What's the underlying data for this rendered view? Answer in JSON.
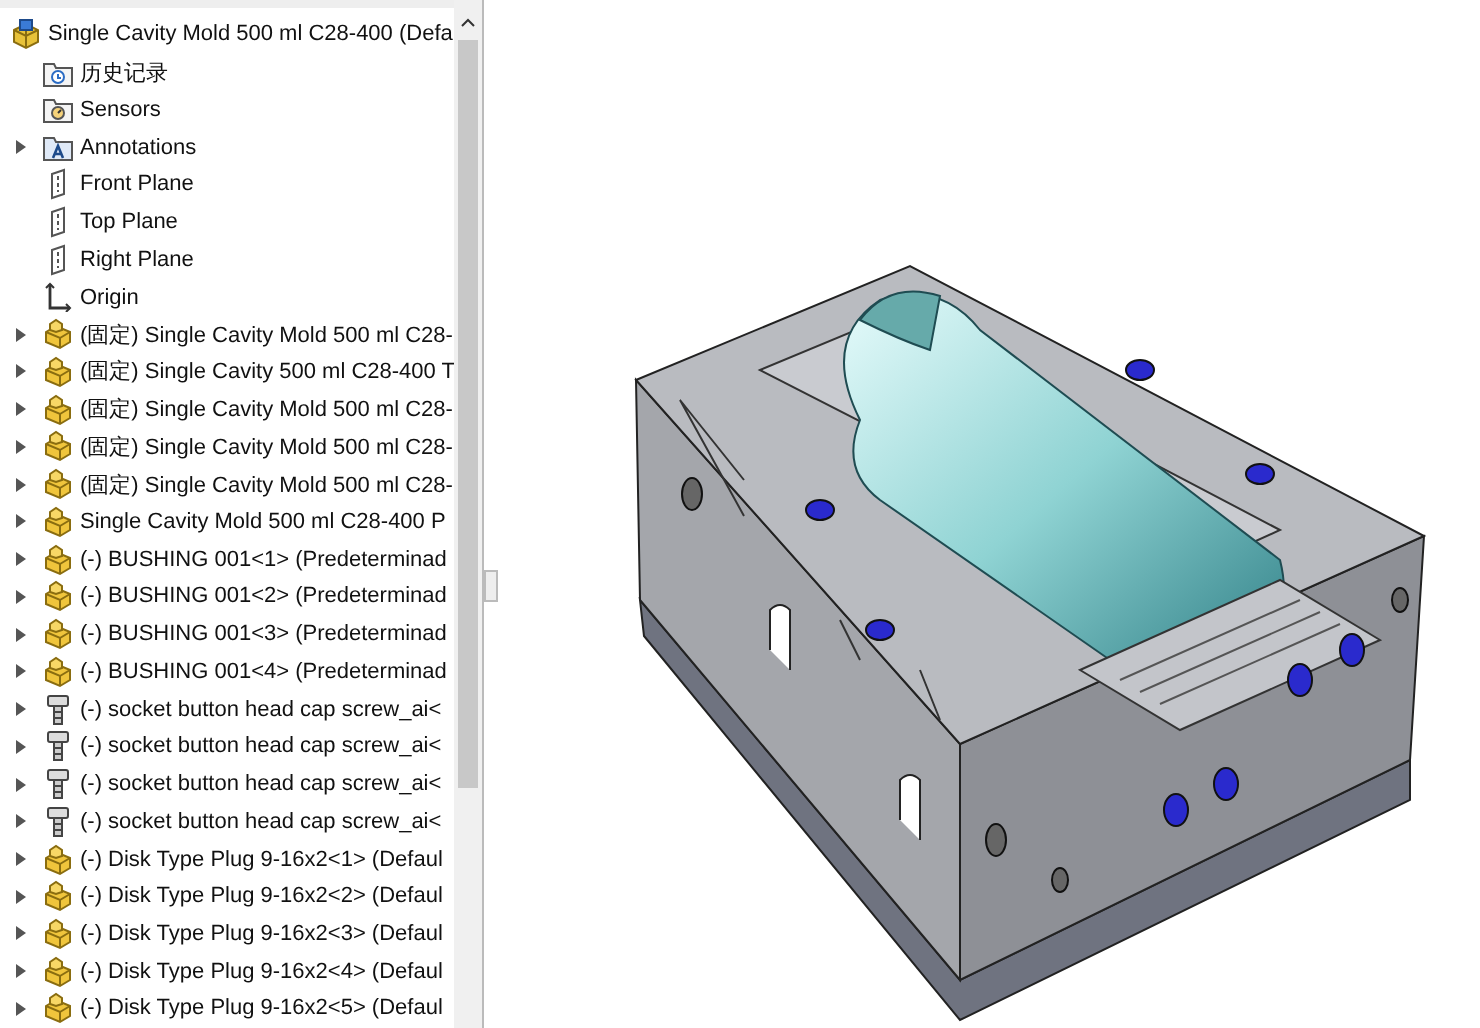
{
  "feature_tree": [
    {
      "label": "Single Cavity Mold 500 ml C28-400  (Defa",
      "kind": "assembly",
      "children": [
        {
          "label": "历史记录",
          "kind": "history"
        },
        {
          "label": "Sensors",
          "kind": "sensors"
        },
        {
          "label": "Annotations",
          "kind": "annotations",
          "expanded": false
        },
        {
          "label": "Front Plane",
          "kind": "plane"
        },
        {
          "label": "Top Plane",
          "kind": "plane"
        },
        {
          "label": "Right Plane",
          "kind": "plane"
        },
        {
          "label": "Origin",
          "kind": "origin"
        },
        {
          "label": "(固定) Single Cavity Mold 500 ml C28-",
          "kind": "part",
          "expanded": false
        },
        {
          "label": "(固定) Single Cavity 500 ml C28-400 T",
          "kind": "part",
          "expanded": false
        },
        {
          "label": "(固定) Single Cavity Mold 500 ml C28-",
          "kind": "part",
          "expanded": false
        },
        {
          "label": "(固定) Single Cavity Mold 500 ml C28-",
          "kind": "part",
          "expanded": false
        },
        {
          "label": "(固定) Single Cavity Mold 500 ml C28-",
          "kind": "part",
          "expanded": false
        },
        {
          "label": "Single Cavity Mold 500 ml C28-400 P",
          "kind": "part",
          "expanded": false
        },
        {
          "label": "(-) BUSHING 001<1> (Predeterminad",
          "kind": "part",
          "expanded": false
        },
        {
          "label": "(-) BUSHING 001<2> (Predeterminad",
          "kind": "part",
          "expanded": false
        },
        {
          "label": "(-) BUSHING 001<3> (Predeterminad",
          "kind": "part",
          "expanded": false
        },
        {
          "label": "(-) BUSHING 001<4> (Predeterminad",
          "kind": "part",
          "expanded": false
        },
        {
          "label": "(-) socket button head cap screw_ai<",
          "kind": "screw",
          "expanded": false
        },
        {
          "label": "(-) socket button head cap screw_ai<",
          "kind": "screw",
          "expanded": false
        },
        {
          "label": "(-) socket button head cap screw_ai<",
          "kind": "screw",
          "expanded": false
        },
        {
          "label": "(-) socket button head cap screw_ai<",
          "kind": "screw",
          "expanded": false
        },
        {
          "label": "(-) Disk Type Plug 9-16x2<1> (Defaul",
          "kind": "part",
          "expanded": false
        },
        {
          "label": "(-) Disk Type Plug 9-16x2<2> (Defaul",
          "kind": "part",
          "expanded": false
        },
        {
          "label": "(-) Disk Type Plug 9-16x2<3> (Defaul",
          "kind": "part",
          "expanded": false
        },
        {
          "label": "(-) Disk Type Plug 9-16x2<4> (Defaul",
          "kind": "part",
          "expanded": false
        },
        {
          "label": "(-) Disk Type Plug 9-16x2<5> (Defaul",
          "kind": "part",
          "expanded": false
        }
      ]
    }
  ]
}
